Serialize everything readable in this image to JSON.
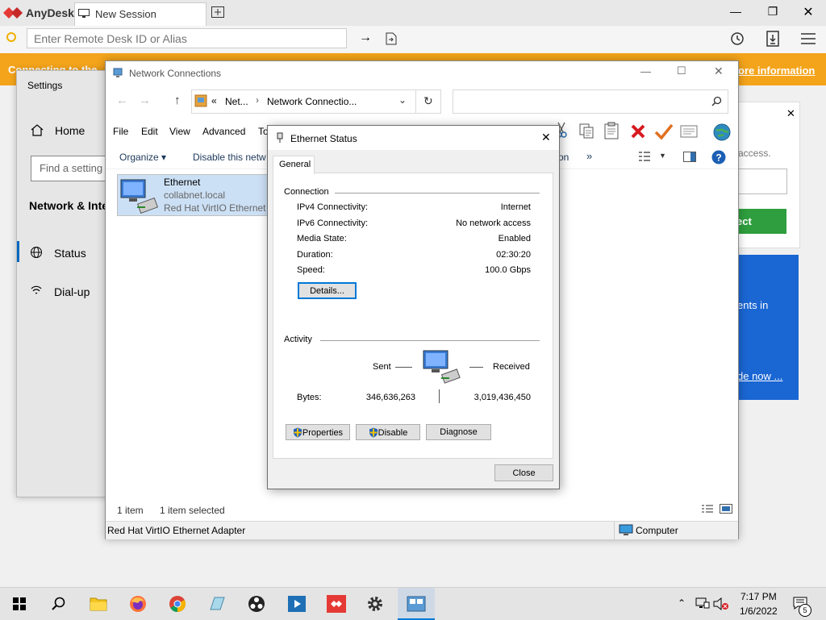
{
  "anydesk": {
    "brand": "AnyDesk",
    "tab_label": "New Session",
    "address_placeholder": "Enter Remote Desk ID or Alias",
    "banner_left": "Connecting to the",
    "banner_right": "ore information",
    "card1_text": "access.",
    "card1_btn": "ect",
    "card2_text1": "ents in",
    "card2_link": "de now ..."
  },
  "settings": {
    "title": "Settings",
    "home": "Home",
    "search_placeholder": "Find a setting",
    "section": "Network & Inte",
    "nav": [
      "Status",
      "Dial-up"
    ]
  },
  "network_connections": {
    "title": "Network Connections",
    "breadcrumb": [
      "Net...",
      "Network Connectio..."
    ],
    "menu": [
      "File",
      "Edit",
      "View",
      "Advanced",
      "To"
    ],
    "cmd_organize": "Organize",
    "cmd_disable": "Disable this netw",
    "cmd_right": "on",
    "item": {
      "name": "Ethernet",
      "network": "collabnet.local",
      "adapter": "Red Hat VirtIO Ethernet A"
    },
    "status_count": "1 item",
    "status_selected": "1 item selected",
    "footer_left": "Red Hat VirtIO Ethernet Adapter",
    "footer_right": "Computer"
  },
  "ethernet_status": {
    "title": "Ethernet Status",
    "tab": "General",
    "connection_header": "Connection",
    "rows": [
      {
        "label": "IPv4 Connectivity:",
        "value": "Internet"
      },
      {
        "label": "IPv6 Connectivity:",
        "value": "No network access"
      },
      {
        "label": "Media State:",
        "value": "Enabled"
      },
      {
        "label": "Duration:",
        "value": "02:30:20"
      },
      {
        "label": "Speed:",
        "value": "100.0 Gbps"
      }
    ],
    "details_btn": "Details...",
    "activity_header": "Activity",
    "sent_label": "Sent",
    "received_label": "Received",
    "bytes_label": "Bytes:",
    "bytes_sent": "346,636,263",
    "bytes_received": "3,019,436,450",
    "properties_btn": "Properties",
    "disable_btn": "Disable",
    "diagnose_btn": "Diagnose",
    "close_btn": "Close"
  },
  "taskbar": {
    "time": "7:17 PM",
    "date": "1/6/2022",
    "notification_count": "5"
  },
  "colors": {
    "anydesk_red": "#e53935",
    "banner": "#f4a41b",
    "accent_blue": "#1a66d3",
    "green": "#2e9e3e"
  }
}
